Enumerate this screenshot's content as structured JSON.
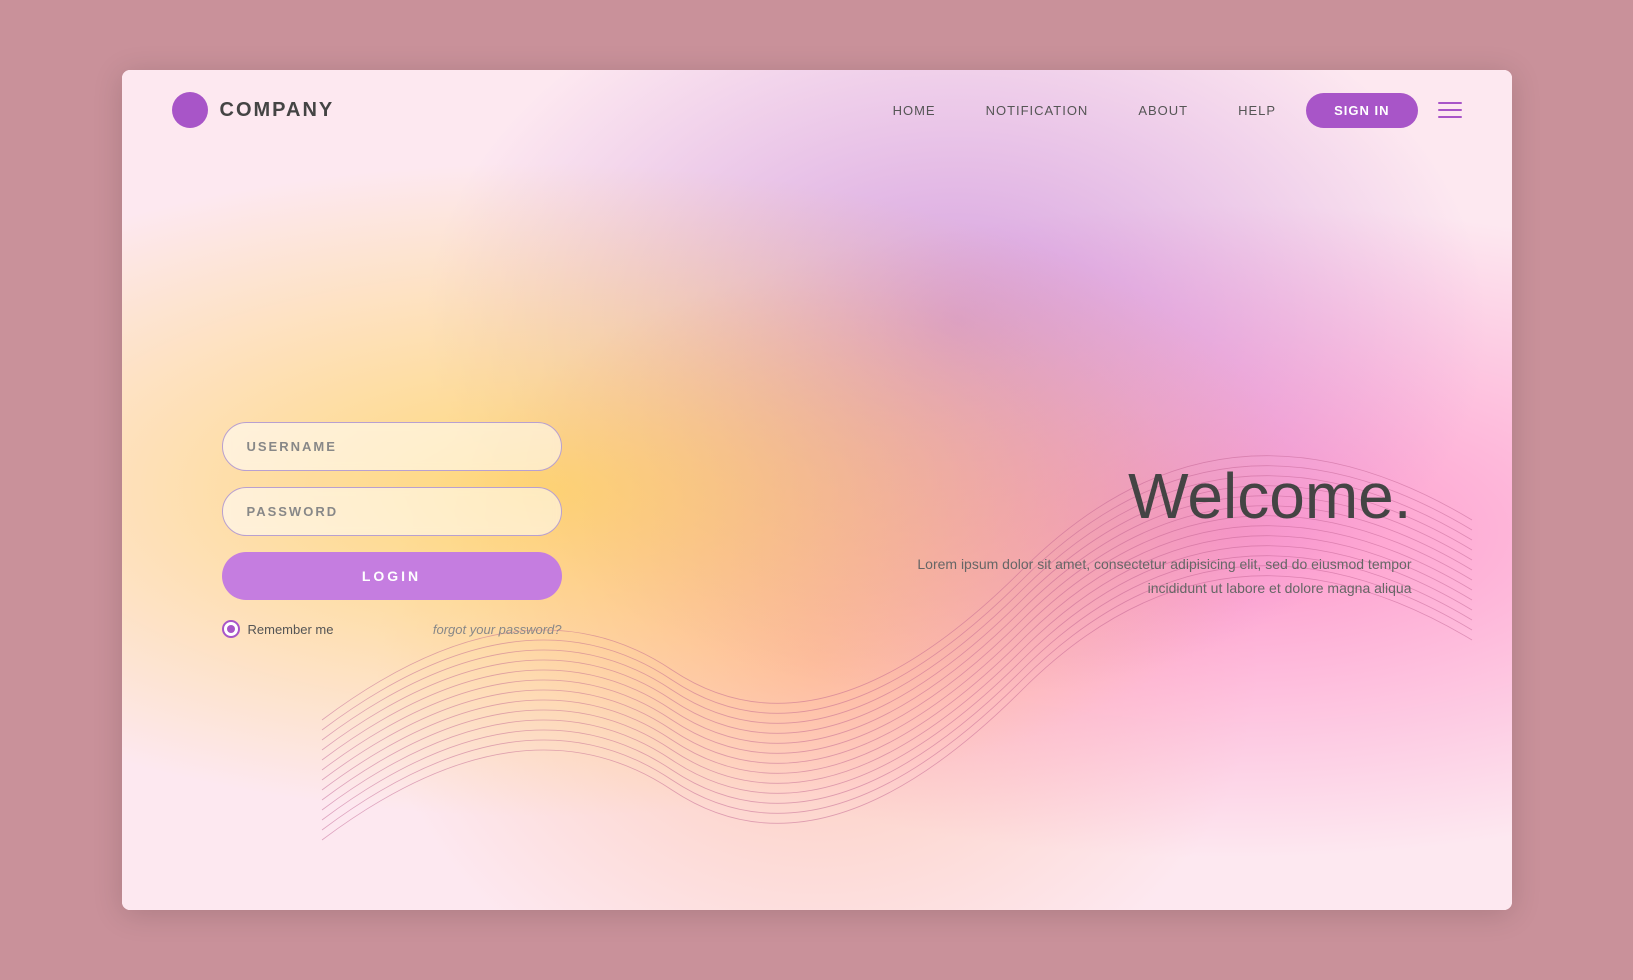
{
  "page": {
    "background_color": "#c9919a"
  },
  "navbar": {
    "company_name": "COMPANY",
    "logo_color": "#a855c8",
    "links": [
      {
        "label": "HOME",
        "id": "home"
      },
      {
        "label": "NOTIFICATION",
        "id": "notification"
      },
      {
        "label": "ABOUT",
        "id": "about"
      },
      {
        "label": "HELP",
        "id": "help"
      }
    ],
    "sign_in_label": "SIGN IN"
  },
  "login_form": {
    "username_placeholder": "USERNAME",
    "password_placeholder": "PASSWORD",
    "login_button": "LOGIN",
    "remember_label": "Remember me",
    "forgot_label": "forgot your password?"
  },
  "hero": {
    "title": "Welcome.",
    "description": "Lorem ipsum dolor sit amet, consectetur adipisicing elit,\nsed do eiusmod tempor incididunt ut labore et dolore magna aliqua"
  }
}
